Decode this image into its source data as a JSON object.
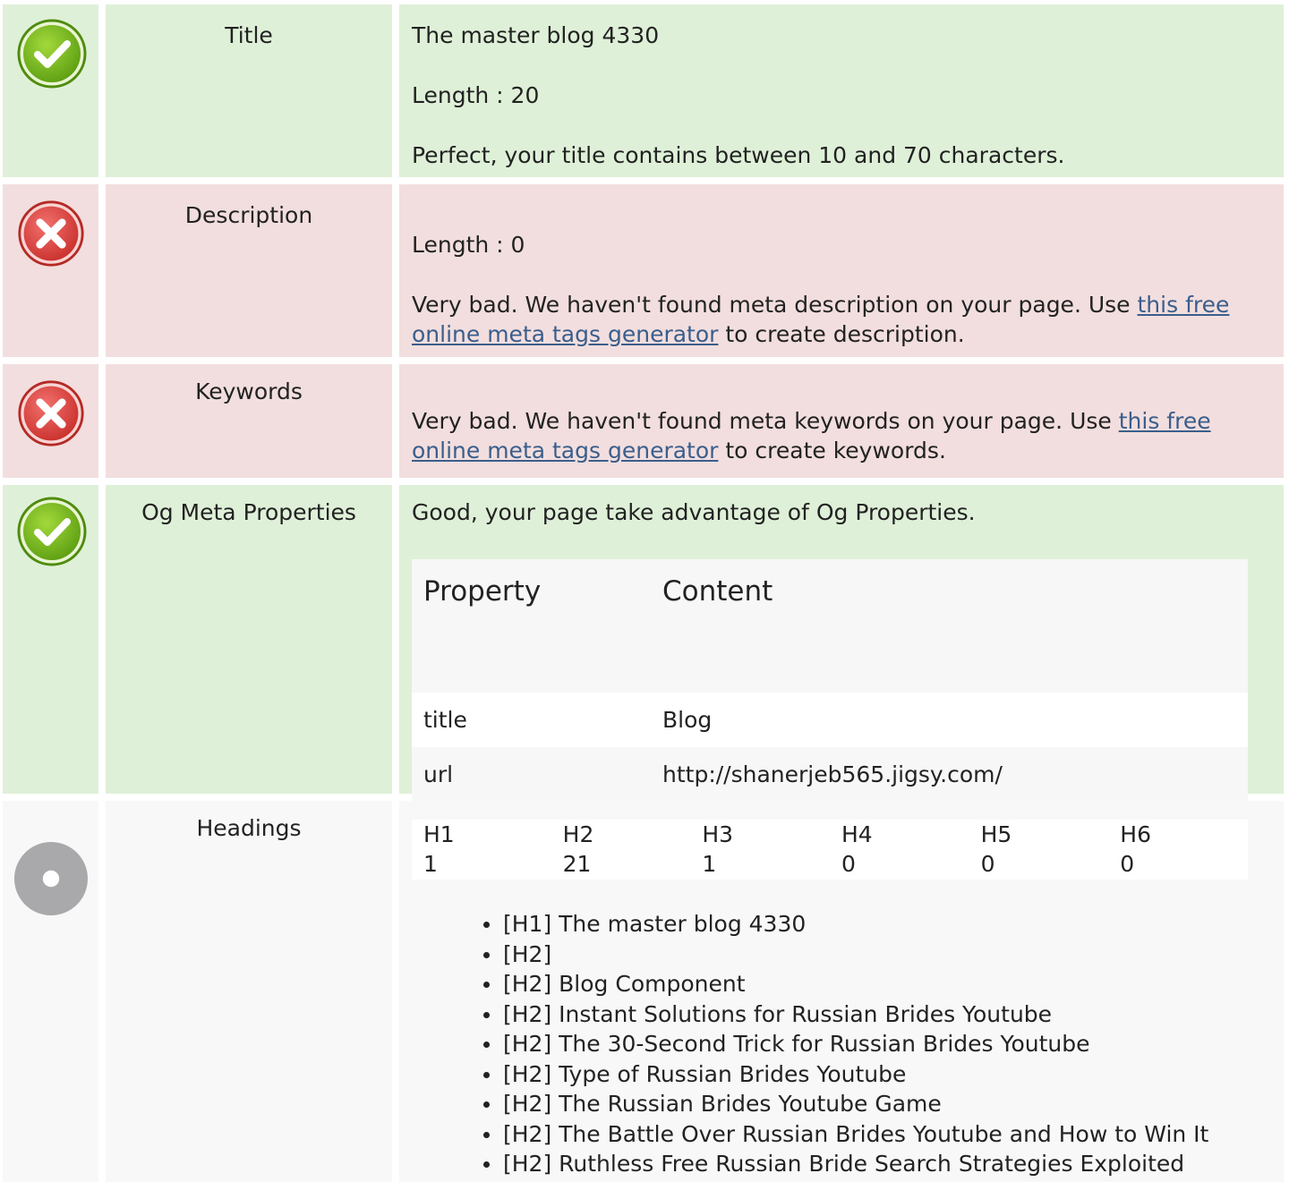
{
  "title_row": {
    "label": "Title",
    "value": "The master blog 4330",
    "length": "Length : 20",
    "message": "Perfect, your title contains between 10 and 70 characters.",
    "status": "good"
  },
  "description_row": {
    "label": "Description",
    "length": "Length : 0",
    "message_before": "Very bad. We haven't found meta description on your page. Use ",
    "link_text": "this free online meta tags generator",
    "message_after": " to create description.",
    "status": "bad"
  },
  "keywords_row": {
    "label": "Keywords",
    "message_before": "Very bad. We haven't found meta keywords on your page. Use ",
    "link_text": "this free online meta tags generator",
    "message_after": " to create keywords.",
    "status": "bad"
  },
  "og_row": {
    "label": "Og Meta Properties",
    "message": "Good, your page take advantage of Og Properties.",
    "table": {
      "headers": [
        "Property",
        "Content"
      ],
      "rows": [
        [
          "title",
          "Blog"
        ],
        [
          "url",
          "http://shanerjeb565.jigsy.com/"
        ]
      ]
    },
    "status": "good"
  },
  "headings_row": {
    "label": "Headings",
    "levels": [
      "H1",
      "H2",
      "H3",
      "H4",
      "H5",
      "H6"
    ],
    "counts": [
      "1",
      "21",
      "1",
      "0",
      "0",
      "0"
    ],
    "items": [
      "[H1] The master blog 4330",
      "[H2]",
      "[H2] Blog Component",
      "[H2] Instant Solutions for Russian Brides Youtube",
      "[H2] The 30-Second Trick for Russian Brides Youtube",
      "[H2] Type of Russian Brides Youtube",
      "[H2] The Russian Brides Youtube Game",
      "[H2] The Battle Over Russian Brides Youtube and How to Win It",
      "[H2] Ruthless Free Russian Bride Search Strategies Exploited"
    ],
    "status": "info"
  },
  "colors": {
    "good_bg": "#dff0d8",
    "bad_bg": "#f2dede",
    "info_bg": "#f8f8f8",
    "link": "#3a5e8c"
  },
  "icons": {
    "good": "check-circle-icon",
    "bad": "x-circle-icon",
    "info": "info-dot-icon"
  }
}
